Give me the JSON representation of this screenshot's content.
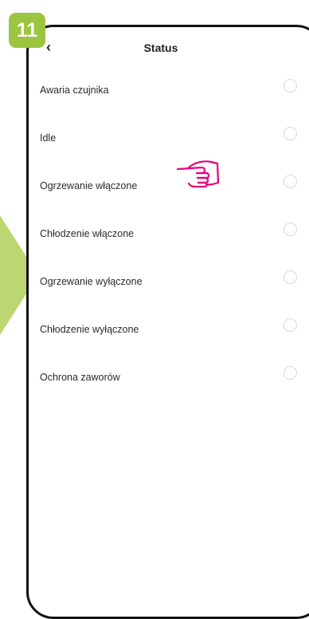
{
  "badge": {
    "step_number": "11",
    "color": "#9bc43f"
  },
  "header": {
    "back_icon": "chevron-left-icon",
    "title": "Status"
  },
  "status_options": [
    {
      "label": "Awaria czujnika",
      "selected": false
    },
    {
      "label": "Idle",
      "selected": false
    },
    {
      "label": "Ogrzewanie włączone",
      "selected": false
    },
    {
      "label": "Chłodzenie włączone",
      "selected": false
    },
    {
      "label": "Ogrzewanie wyłączone",
      "selected": false
    },
    {
      "label": "Chłodzenie wyłączone",
      "selected": false
    },
    {
      "label": "Ochrona zaworów",
      "selected": false
    }
  ],
  "annotation": {
    "icon": "pointing-hand-icon",
    "color": "#e6007e"
  }
}
